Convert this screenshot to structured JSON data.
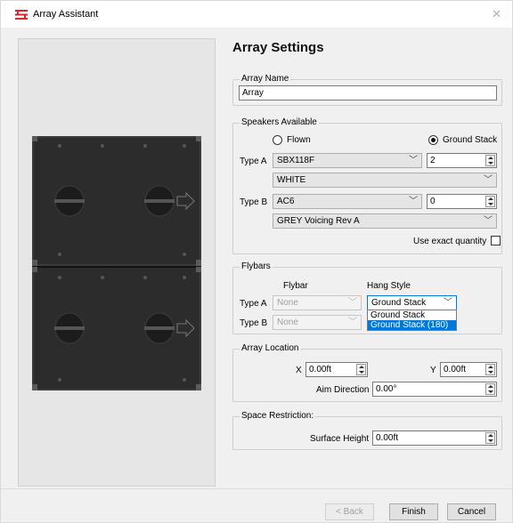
{
  "window": {
    "title": "Array Assistant",
    "close_glyph": "✕",
    "logo_icon": "array-logo-icon"
  },
  "heading": "Array Settings",
  "array_name": {
    "group_label": "Array Name",
    "value": "Array"
  },
  "speakers": {
    "group_label": "Speakers Available",
    "flown_label": "Flown",
    "ground_stack_label": "Ground Stack",
    "selected_mode": "Ground Stack",
    "type_a_label": "Type A",
    "type_a_model": "SBX118F",
    "type_a_qty": "2",
    "type_a_color": "WHITE",
    "type_b_label": "Type B",
    "type_b_model": "AC6",
    "type_b_qty": "0",
    "type_b_voicing": "GREY Voicing Rev A",
    "exact_qty_label": "Use exact quantity",
    "exact_qty_checked": false
  },
  "flybars": {
    "group_label": "Flybars",
    "flybar_col": "Flybar",
    "hang_style_col": "Hang Style",
    "type_a_label": "Type A",
    "type_a_flybar": "None",
    "type_a_hang": "Ground Stack",
    "type_b_label": "Type B",
    "type_b_flybar": "None",
    "hang_options": [
      "Ground Stack",
      "Ground Stack (180)"
    ],
    "highlighted_option": "Ground Stack (180)"
  },
  "location": {
    "group_label": "Array Location",
    "x_label": "X",
    "x_value": "0.00ft",
    "y_label": "Y",
    "y_value": "0.00ft",
    "aim_label": "Aim Direction",
    "aim_value": "0.00°"
  },
  "restriction": {
    "group_label": "Space Restriction:",
    "surface_label": "Surface Height",
    "surface_value": "0.00ft"
  },
  "buttons": {
    "back": "< Back",
    "finish": "Finish",
    "cancel": "Cancel"
  },
  "colors": {
    "accent": "#0078d7",
    "speaker_body": "#2b2b2b",
    "logo_red": "#d9262c"
  }
}
